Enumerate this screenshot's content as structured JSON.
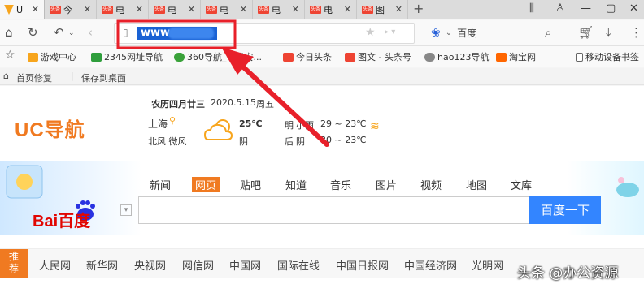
{
  "tabs": [
    {
      "title": "U",
      "icon": "uc-icon"
    },
    {
      "title": "今",
      "icon": "toutiao-icon"
    },
    {
      "title": "电",
      "icon": "toutiao-icon"
    },
    {
      "title": "电",
      "icon": "toutiao-icon"
    },
    {
      "title": "电",
      "icon": "toutiao-icon"
    },
    {
      "title": "电",
      "icon": "toutiao-icon"
    },
    {
      "title": "电",
      "icon": "toutiao-icon"
    },
    {
      "title": "图",
      "icon": "toutiao-icon"
    }
  ],
  "tab_icon_text": "头条",
  "address_bar": {
    "url_prefix": "www."
  },
  "search_engine": {
    "name": "百度"
  },
  "bookmarks": [
    {
      "label": "游戏中心",
      "color": "#f7a51d"
    },
    {
      "label": "2345网址导航",
      "color": "#2f9e3c"
    },
    {
      "label": "360导航_一代安...",
      "color": "#3aa23a"
    },
    {
      "label": "今日头条",
      "color": "#e43"
    },
    {
      "label": "图文 - 头条号",
      "color": "#e43"
    },
    {
      "label": "hao123导航",
      "color": "#888"
    },
    {
      "label": "淘宝网",
      "color": "#f60"
    },
    {
      "label": "移动设备书签",
      "color": "#666"
    }
  ],
  "homebar": {
    "repair": "首页修复",
    "save_desktop": "保存到桌面"
  },
  "page": {
    "logo": "UC导航",
    "lunar_date": "农历四月廿三",
    "date": "2020.5.15",
    "weekday": "周五",
    "city": "上海",
    "wind": "北风 微风",
    "temp_now": "25℃",
    "weather_now": "阴",
    "tomorrow_label": "明",
    "tomorrow_weather": "小雨",
    "tomorrow_temp": "29 ~ 23℃",
    "after_label": "后",
    "after_weather": "阴",
    "after_temp": "30 ~ 23℃"
  },
  "baidu": {
    "tabs": [
      "新闻",
      "网页",
      "贴吧",
      "知道",
      "音乐",
      "图片",
      "视频",
      "地图",
      "文库"
    ],
    "active_tab": "网页",
    "logo": "Bai百度",
    "button": "百度一下"
  },
  "links": {
    "tag_line1": "推",
    "tag_line2": "荐",
    "sites": [
      "人民网",
      "新华网",
      "央视网",
      "网信网",
      "中国网",
      "国际在线",
      "中国日报网",
      "中国经济网",
      "光明网"
    ]
  },
  "watermark": "头条 @办公资源",
  "colors": {
    "accent": "#f07a21",
    "arrow": "#e8202a",
    "baidu_blue": "#3385ff"
  }
}
